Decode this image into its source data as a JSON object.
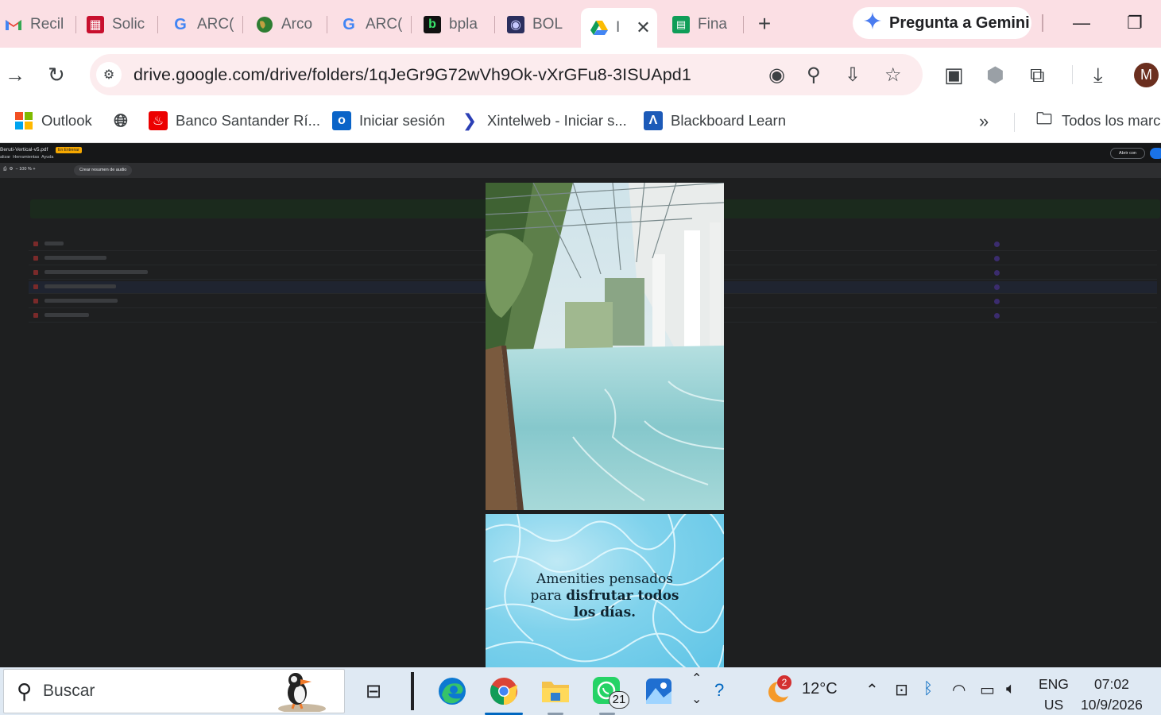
{
  "browser": {
    "tabs": [
      {
        "label": "Recil",
        "icon": "gmail-icon",
        "color": "#ea4335"
      },
      {
        "label": "Solic",
        "icon": "grid-app-icon",
        "color": "#c8102e"
      },
      {
        "label": "ARC(",
        "icon": "google-icon",
        "color": "#4285f4"
      },
      {
        "label": "Arco",
        "icon": "globe-icon",
        "color": "#34a853"
      },
      {
        "label": "ARC(",
        "icon": "google-icon",
        "color": "#4285f4"
      },
      {
        "label": "bpla",
        "icon": "bplay-icon",
        "color": "#1db954"
      },
      {
        "label": "BOL",
        "icon": "bol-icon",
        "color": "#3a3f7a"
      },
      {
        "label": "I",
        "icon": "drive-icon",
        "color": "#fbbc04"
      },
      {
        "label": "Fina",
        "icon": "sheets-icon",
        "color": "#0f9d58"
      }
    ],
    "active_tab_index": 7,
    "close_glyph": "✕",
    "new_tab_glyph": "+",
    "gemini_label": "Pregunta a Gemini",
    "url": "drive.google.com/drive/folders/1qJeGr9G72wVh9Ok-vXrGFu8-3ISUApd1",
    "avatar_letter": "M",
    "bookmarks": [
      {
        "label": "Outlook",
        "icon": "microsoft-icon"
      },
      {
        "label": "",
        "icon": "globe-icon"
      },
      {
        "label": "Banco Santander Rí...",
        "icon": "santander-icon"
      },
      {
        "label": "Iniciar sesión",
        "icon": "outlook-login-icon"
      },
      {
        "label": "Xintelweb - Iniciar s...",
        "icon": "xintel-icon"
      },
      {
        "label": "Blackboard Learn",
        "icon": "blackboard-icon"
      }
    ],
    "bookmarks_overflow": "»",
    "all_bookmarks_label": "Todos los marca"
  },
  "pdf_viewer": {
    "file_name": "Beruti-Vertical-v5.pdf",
    "badge": "En Entrenar",
    "menu": [
      "alizar",
      "Herramientas",
      "Ayuda"
    ],
    "zoom": "100 %",
    "audio_summary_chip": "Crear resumen de audio",
    "open_with_label": "Abrir con",
    "page2_caption_line1": "Amenities pensados",
    "page2_caption_line2_pre": "para ",
    "page2_caption_line2_bold": "disfrutar todos",
    "page2_caption_line3_bold": "los días."
  },
  "taskbar": {
    "search_placeholder": "Buscar",
    "whatsapp_badge": "21",
    "weather_badge": "2",
    "temperature": "12°C",
    "language_line1": "ENG",
    "language_line2": "US",
    "time": "07:02",
    "date": "10/9/2026"
  }
}
